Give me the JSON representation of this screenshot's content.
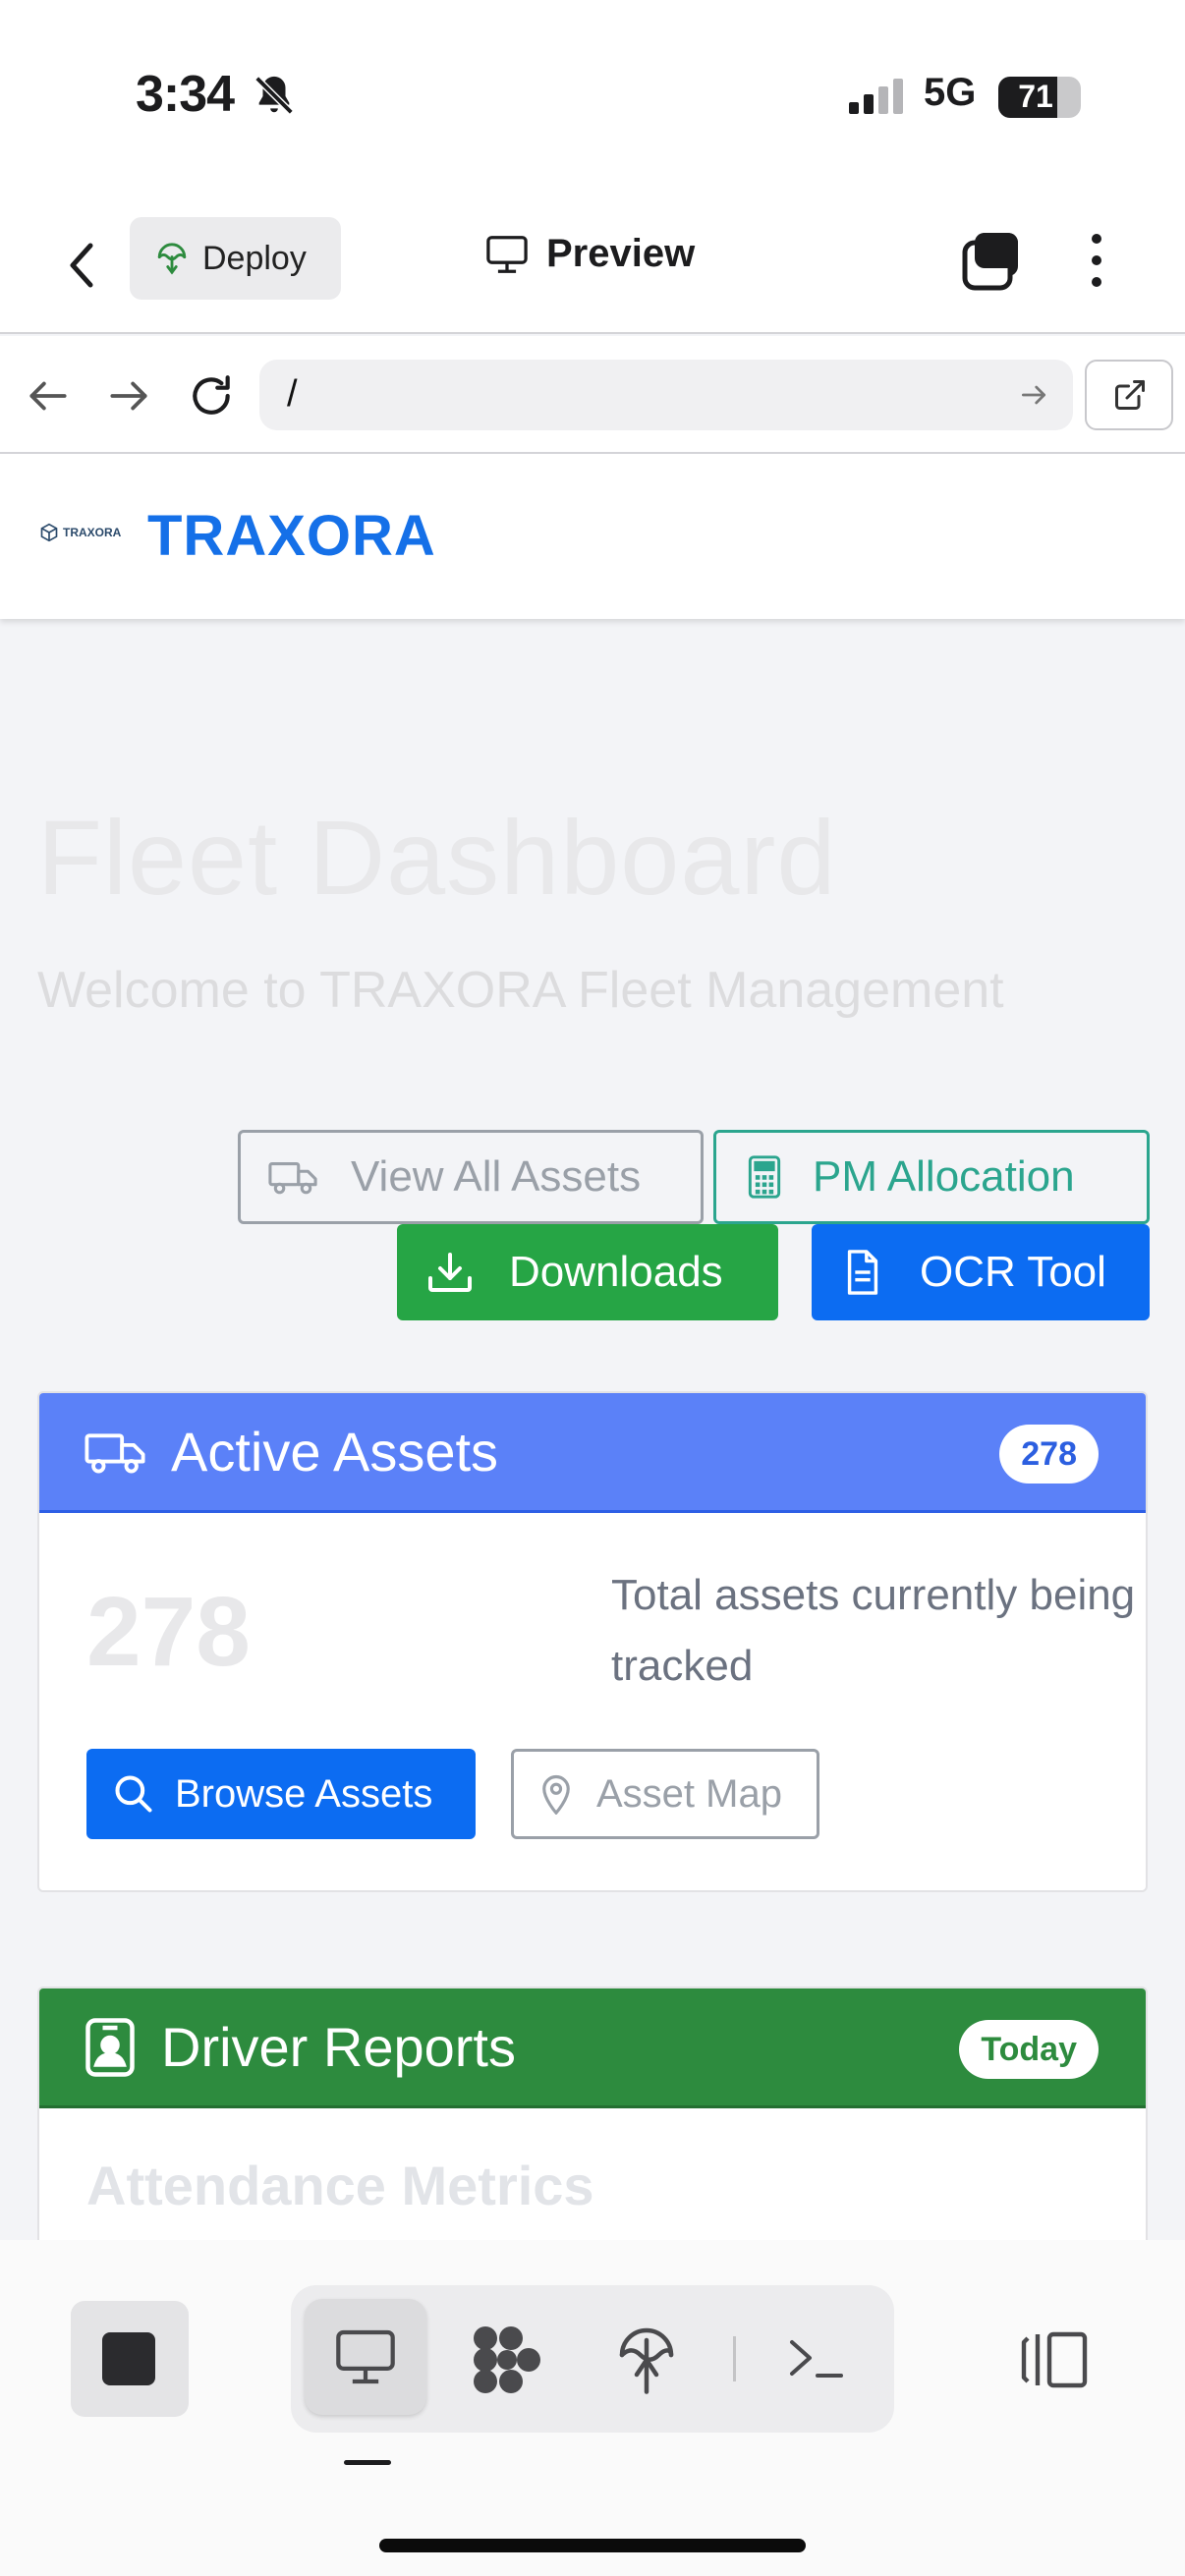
{
  "status_bar": {
    "time": "3:34",
    "network": "5G",
    "battery": "71",
    "battery_level": 0.71
  },
  "app_bar": {
    "deploy_label": "Deploy",
    "preview_label": "Preview"
  },
  "browser": {
    "url": "/"
  },
  "site": {
    "logo_text": "TRAXORA",
    "brand": "TRAXORA",
    "page_title": "Fleet Dashboard",
    "page_subtitle": "Welcome to TRAXORA Fleet Management",
    "actions": {
      "view_all_assets": "View All Assets",
      "pm_allocation": "PM Allocation",
      "downloads": "Downloads",
      "ocr_tool": "OCR Tool"
    },
    "active_assets": {
      "title": "Active Assets",
      "badge": "278",
      "count": "278",
      "description": "Total assets currently being tracked",
      "browse_label": "Browse Assets",
      "map_label": "Asset Map"
    },
    "driver_reports": {
      "title": "Driver Reports",
      "badge": "Today",
      "section_title": "Attendance Metrics"
    }
  },
  "colors": {
    "brand": "#1570e8",
    "primary": "#0c6cf2",
    "success": "#26a545",
    "teal": "#2ba58e",
    "assets_header": "#5b81f8",
    "drivers_header": "#2d8b3e"
  },
  "dock": {
    "icons": [
      "stop-icon",
      "monitor-icon",
      "grid-icon",
      "deploy-icon",
      "terminal-icon",
      "panel-icon"
    ]
  }
}
